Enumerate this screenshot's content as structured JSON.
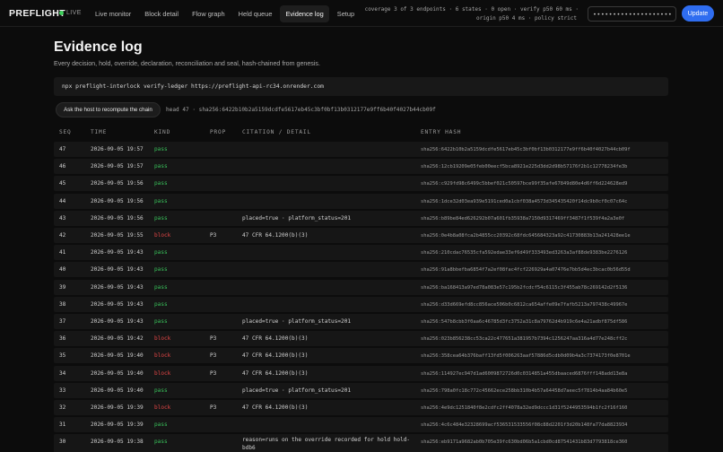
{
  "app": {
    "brand": "PREFLIGHT",
    "live": "LIVE"
  },
  "nav": {
    "tabs": [
      "Live monitor",
      "Block detail",
      "Flow graph",
      "Held queue",
      "Evidence log",
      "Setup"
    ],
    "active": 4
  },
  "status": {
    "line1": "coverage 3 of 3 endpoints · 6 states · 0 open · verify p50 60 ms ·",
    "line2": "origin p50 4 ms · policy strict"
  },
  "token": {
    "value": "••••••••••••••••••••••••"
  },
  "update_label": "Update",
  "page": {
    "title": "Evidence log",
    "subtitle": "Every decision, hold, override, declaration, reconciliation and seal, hash-chained from genesis."
  },
  "command": "npx preflight-interlock verify-ledger https://preflight-api-rc34.onrender.com",
  "recompute_label": "Ask the host to recompute the chain",
  "head_info": "head 47 · sha256:6422b10b2a5159dcdfe5617eb45c3bf0bf13b0312177e9ff6b40f4027b44cb09f",
  "table": {
    "headers": {
      "seq": "SEQ",
      "time": "TIME",
      "kind": "KIND",
      "prop": "PROP",
      "detail": "CITATION / DETAIL",
      "hash": "ENTRY HASH"
    },
    "rows": [
      {
        "seq": "47",
        "time": "2026-09-05 19:57",
        "kind": "pass",
        "prop": "",
        "detail": "",
        "hash": "sha256:6422b10b2a5159dcdfe5617eb45c3bf0bf13b0312177e9ff6b40f4027b44cb09f"
      },
      {
        "seq": "46",
        "time": "2026-09-05 19:57",
        "kind": "pass",
        "prop": "",
        "detail": "",
        "hash": "sha256:12cb19209e05feb00eecf5bca8921e225d3dd2d98b57176f2b1c12778234fe3b"
      },
      {
        "seq": "45",
        "time": "2026-09-05 19:56",
        "kind": "pass",
        "prop": "",
        "detail": "",
        "hash": "sha256:c929fd98c6499c5bbef021c50597bce99f35afe67849d80e4d6ff6d224628ed9"
      },
      {
        "seq": "44",
        "time": "2026-09-05 19:56",
        "kind": "pass",
        "prop": "",
        "detail": "",
        "hash": "sha256:1dce32d03ea939e5191ced0a1cbf038a4573d345435420f14dc9b0cf0c07c64c"
      },
      {
        "seq": "43",
        "time": "2026-09-05 19:56",
        "kind": "pass",
        "prop": "",
        "detail": "placed=true · platform_status=201",
        "hash": "sha256:b89be84ed626292b07a601fb35938a7150d9317469ff3487f1f539f4a2a3e0f"
      },
      {
        "seq": "42",
        "time": "2026-09-05 19:55",
        "kind": "block",
        "prop": "P3",
        "detail": "47 CFR 64.1200(b)(3)",
        "hash": "sha256:0e4b8a08fca2b4855cc20392c68fdc645684323a92c41730883b13a241428ee1e"
      },
      {
        "seq": "41",
        "time": "2026-09-05 19:43",
        "kind": "pass",
        "prop": "",
        "detail": "",
        "hash": "sha256:210cdac76535cfa592edae33ef6d49f333493ed3263a3af88de9383be2276126"
      },
      {
        "seq": "40",
        "time": "2026-09-05 19:43",
        "kind": "pass",
        "prop": "",
        "detail": "",
        "hash": "sha256:91a8bbefba6854f7a2ef08fac4fcf226929a4a07476e7bb5d4ec3bcac0b56d55d"
      },
      {
        "seq": "39",
        "time": "2026-09-05 19:43",
        "kind": "pass",
        "prop": "",
        "detail": "",
        "hash": "sha256:ba168413a97ed78a083e57c195b2fcdcf54c6115c3f455ab78c269142d2f5136"
      },
      {
        "seq": "38",
        "time": "2026-09-05 19:43",
        "kind": "pass",
        "prop": "",
        "detail": "",
        "hash": "sha256:d33d669efd8cc856ace506b0c6812ca654affe09e7fafb5213a797438c49967e"
      },
      {
        "seq": "37",
        "time": "2026-09-05 19:43",
        "kind": "pass",
        "prop": "",
        "detail": "placed=true · platform_status=201",
        "hash": "sha256:547b8cbb3f0aa6c46785d3fc3752a31c8a79762d4b919c6e4a21adbf875df586"
      },
      {
        "seq": "36",
        "time": "2026-09-05 19:42",
        "kind": "block",
        "prop": "P3",
        "detail": "47 CFR 64.1200(b)(3)",
        "hash": "sha256:023b856238cc53ca22c477651a381957b7394c1256247aa316a4d77e248cff2c"
      },
      {
        "seq": "35",
        "time": "2026-09-05 19:40",
        "kind": "block",
        "prop": "P3",
        "detail": "47 CFR 64.1200(b)(3)",
        "hash": "sha256:358cea64b376baff13fd5f006263aaf57886d5cdb0d09b4a3c7374173f0e8701e"
      },
      {
        "seq": "34",
        "time": "2026-09-05 19:40",
        "kind": "block",
        "prop": "P3",
        "detail": "47 CFR 64.1200(b)(3)",
        "hash": "sha256:114927ec947d1ad6009872726d0c0314851a455dbaaced6876fff148add13e8a"
      },
      {
        "seq": "33",
        "time": "2026-09-05 19:40",
        "kind": "pass",
        "prop": "",
        "detail": "placed=true · platform_status=201",
        "hash": "sha256:798a0fc18c772c45662ece258bb310b4b57a64458d7aeec5f7814b4aa84b60e5"
      },
      {
        "seq": "32",
        "time": "2026-09-05 19:39",
        "kind": "block",
        "prop": "P3",
        "detail": "47 CFR 64.1200(b)(3)",
        "hash": "sha256:4e9dc1251840f8e2cdfc2ff4078a32ed9dccc1d31f5244953594b1fc2f16f160"
      },
      {
        "seq": "31",
        "time": "2026-09-05 19:39",
        "kind": "pass",
        "prop": "",
        "detail": "",
        "hash": "sha256:4c6c484e32328699acf536531533556f08c88d2201f3d20b148fa77da8823934"
      },
      {
        "seq": "30",
        "time": "2026-09-05 19:38",
        "kind": "pass",
        "prop": "",
        "detail": "reason=runs on the override recorded for hold hold-bdb6",
        "hash": "sha256:eb9171a9682ab0b705e39fc630bd06b5a1cbd0cd87541431b83d7793818ce360"
      }
    ]
  }
}
